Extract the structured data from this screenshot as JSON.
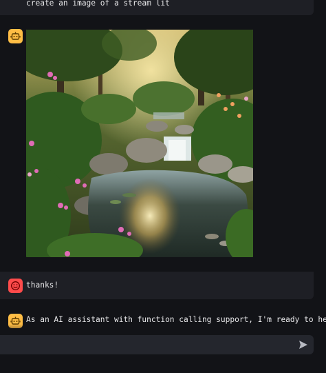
{
  "messages": [
    {
      "role": "user",
      "avatar_icon": "bot-face-icon",
      "text": "create an image of a stream lit"
    },
    {
      "role": "assistant",
      "avatar_icon": "bot-face-icon",
      "image_description_icon": "generated-image"
    },
    {
      "role": "user",
      "avatar_icon": "smiley-face-icon",
      "text": "thanks!"
    },
    {
      "role": "assistant",
      "avatar_icon": "bot-face-icon",
      "text": "As an AI assistant with function calling support, I'm ready to help"
    }
  ],
  "chat_input": {
    "placeholder": "",
    "value": ""
  },
  "icons": {
    "send": "send-icon"
  },
  "colors": {
    "background": "#121317",
    "user_message_bg": "#1e1f25",
    "bot_avatar": "#ffbd45",
    "user_avatar": "#ff4b4b",
    "input_bg": "#24262d"
  }
}
